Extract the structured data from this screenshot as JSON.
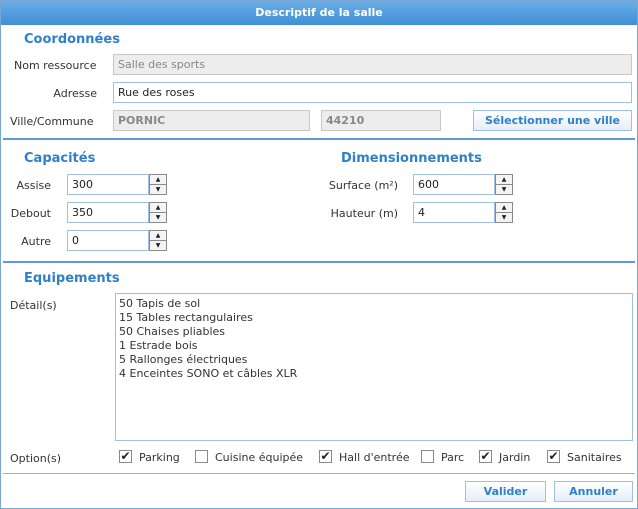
{
  "title": "Descriptif de la salle",
  "coordonnees": {
    "heading": "Coordonnées",
    "nom_label": "Nom ressource",
    "nom_value": "Salle des sports",
    "adresse_label": "Adresse",
    "adresse_value": "Rue des roses",
    "ville_label": "Ville/Commune",
    "ville_value": "PORNIC",
    "cp_value": "44210",
    "select_city_label": "Sélectionner une ville"
  },
  "capacites": {
    "heading": "Capacités",
    "assise_label": "Assise",
    "assise_value": "300",
    "debout_label": "Debout",
    "debout_value": "350",
    "autre_label": "Autre",
    "autre_value": "0"
  },
  "dimensionnements": {
    "heading": "Dimensionnements",
    "surface_label": "Surface (m²)",
    "surface_value": "600",
    "hauteur_label": "Hauteur (m)",
    "hauteur_value": "4"
  },
  "equipements": {
    "heading": "Equipements",
    "detail_label": "Détail(s)",
    "detail_lines": [
      "50 Tapis de sol",
      "15 Tables rectangulaires",
      "50 Chaises pliables",
      "1 Estrade bois",
      "5 Rallonges électriques",
      "4 Enceintes SONO et câbles XLR"
    ],
    "options_label": "Option(s)",
    "options": [
      {
        "label": "Parking",
        "checked": true
      },
      {
        "label": "Cuisine équipée",
        "checked": false
      },
      {
        "label": "Hall d'entrée",
        "checked": true
      },
      {
        "label": "Parc",
        "checked": false
      },
      {
        "label": "Jardin",
        "checked": true
      },
      {
        "label": "Sanitaires",
        "checked": true
      }
    ]
  },
  "footer": {
    "validate_label": "Valider",
    "cancel_label": "Annuler"
  },
  "icons": {
    "spinner_up": "triangle-up-icon",
    "spinner_down": "triangle-down-icon",
    "check": "check-icon"
  },
  "colors": {
    "accent": "#2f80c8",
    "titlebar": "#4a97dc",
    "divider": "#5b9bd8"
  }
}
